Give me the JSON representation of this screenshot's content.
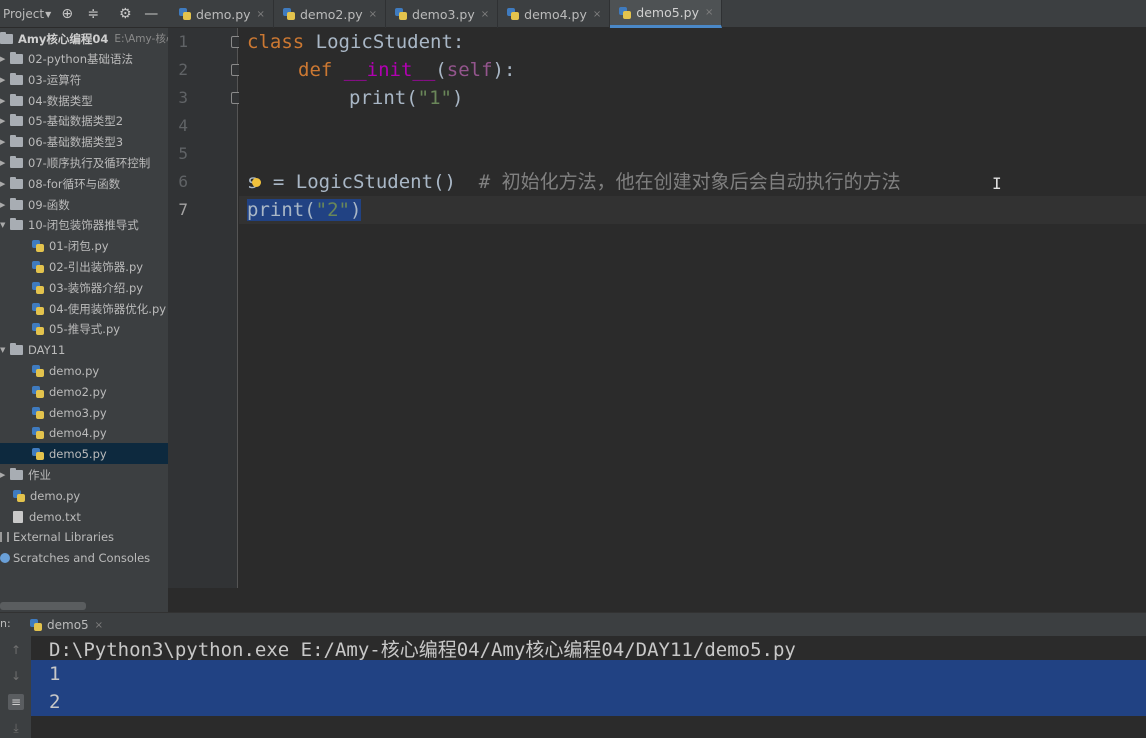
{
  "project_toolbar": {
    "title": "Project"
  },
  "tabs": [
    {
      "label": "demo.py",
      "close": "×"
    },
    {
      "label": "demo2.py",
      "close": "×"
    },
    {
      "label": "demo3.py",
      "close": "×"
    },
    {
      "label": "demo4.py",
      "close": "×"
    },
    {
      "label": "demo5.py",
      "close": "×"
    }
  ],
  "tree": {
    "root": {
      "name": "Amy核心编程04",
      "path": "E:\\Amy-核心"
    },
    "folders": [
      "02-python基础语法",
      "03-运算符",
      "04-数据类型",
      "05-基础数据类型2",
      "06-基础数据类型3",
      "07-顺序执行及循环控制",
      "08-for循环与函数",
      "09-函数",
      "10-闭包装饰器推导式"
    ],
    "closure_files": [
      "01-闭包.py",
      "02-引出装饰器.py",
      "03-装饰器介绍.py",
      "04-使用装饰器优化.py",
      "05-推导式.py"
    ],
    "day11": {
      "name": "DAY11",
      "files": [
        "demo.py",
        "demo2.py",
        "demo3.py",
        "demo4.py",
        "demo5.py"
      ]
    },
    "homework": "作业",
    "root_files": [
      "demo.py",
      "demo.txt"
    ],
    "external": "External Libraries",
    "scratches": "Scratches and Consoles"
  },
  "line_numbers": [
    "1",
    "2",
    "3",
    "4",
    "5",
    "6",
    "7"
  ],
  "code": {
    "l1_kw": "class",
    "l1_rest": " LogicStudent:",
    "l2_kw": "def",
    "l2_method": "__init__",
    "l2_open": "(",
    "l2_self": "self",
    "l2_close": "):",
    "l3_call": "print(",
    "l3_str": "\"1\"",
    "l3_end": ")",
    "l6_a": "s",
    "l6_b": " = LogicStudent()  ",
    "l6_comment": "# 初始化方法，他在创建对象后会自动执行的方法",
    "l7_call": "print(",
    "l7_str": "\"2\"",
    "l7_end": ")"
  },
  "run": {
    "prefix": "n:",
    "tab": "demo5",
    "close": "×",
    "command": "D:\\Python3\\python.exe E:/Amy-核心编程04/Amy核心编程04/DAY11/demo5.py",
    "outputs": [
      "1",
      "2"
    ]
  },
  "colors": {
    "keyword": "#cc7832",
    "string": "#6a8759",
    "comment": "#808080",
    "selection": "#214283",
    "accent": "#4a88c7"
  }
}
